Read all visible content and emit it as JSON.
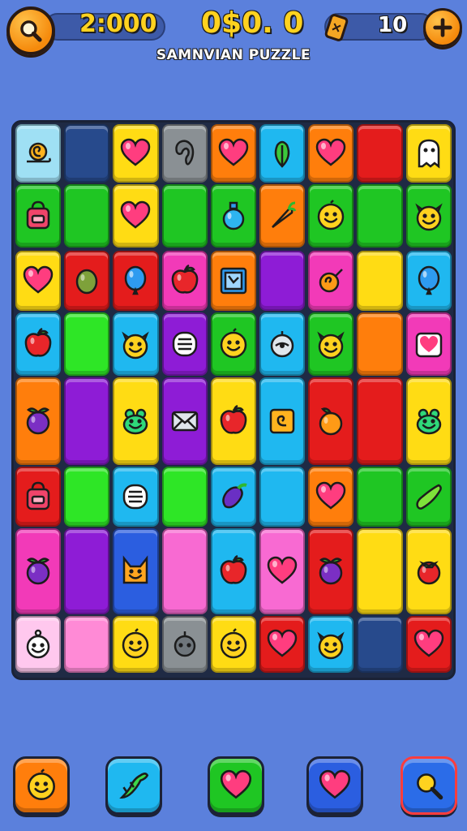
{
  "hud": {
    "title": "SAMNVIAN PUZZLE",
    "timer": "2:000",
    "score": "0$0. 0",
    "moves": "10"
  },
  "colors": {
    "bg": "#5b80dc",
    "lightblue": "#9fe0f4",
    "navy": "#274a8c",
    "yellow": "#ffdc14",
    "gray": "#8a9094",
    "orange": "#ff7e0c",
    "cyan": "#1fb8f0",
    "red": "#e41c1c",
    "green": "#1fc623",
    "lime": "#2ee626",
    "purple": "#8e1cd6",
    "magenta": "#f23ab8",
    "pink": "#ff8ad6",
    "blue": "#2b5ee0",
    "lightpink": "#ffc8ee",
    "lightmagenta": "#f86ad2"
  },
  "board": {
    "rows": [
      [
        {
          "color": "lightblue",
          "icon": "snail-icon"
        },
        {
          "color": "navy",
          "icon": ""
        },
        {
          "color": "yellow",
          "icon": "heart-icon"
        },
        {
          "color": "gray",
          "icon": "ear-icon"
        },
        {
          "color": "orange",
          "icon": "heart-icon"
        },
        {
          "color": "cyan",
          "icon": "leaf-icon"
        },
        {
          "color": "orange",
          "icon": "heart-icon"
        },
        {
          "color": "red",
          "icon": ""
        },
        {
          "color": "yellow",
          "icon": "ghost-icon"
        }
      ],
      [
        {
          "color": "green",
          "icon": "bag-icon"
        },
        {
          "color": "green",
          "icon": ""
        },
        {
          "color": "yellow",
          "icon": "heart-icon"
        },
        {
          "color": "green",
          "icon": ""
        },
        {
          "color": "green",
          "icon": "potion-icon"
        },
        {
          "color": "orange",
          "icon": "carrot-icon"
        },
        {
          "color": "green",
          "icon": "smiley-icon"
        },
        {
          "color": "green",
          "icon": ""
        },
        {
          "color": "green",
          "icon": "cat-face-icon"
        }
      ],
      [
        {
          "color": "yellow",
          "icon": "heart-icon"
        },
        {
          "color": "red",
          "icon": "olive-icon"
        },
        {
          "color": "red",
          "icon": "balloon-icon"
        },
        {
          "color": "magenta",
          "icon": "apple-icon"
        },
        {
          "color": "orange",
          "icon": "frame-icon"
        },
        {
          "color": "purple",
          "icon": ""
        },
        {
          "color": "magenta",
          "icon": "candy-icon"
        },
        {
          "color": "yellow",
          "icon": ""
        },
        {
          "color": "cyan",
          "icon": "balloon-icon"
        }
      ],
      [
        {
          "color": "cyan",
          "icon": "apple-icon"
        },
        {
          "color": "lime",
          "icon": ""
        },
        {
          "color": "cyan",
          "icon": "cat-face-icon"
        },
        {
          "color": "purple",
          "icon": "scroll-icon"
        },
        {
          "color": "green",
          "icon": "smiley-icon"
        },
        {
          "color": "cyan",
          "icon": "robot-icon"
        },
        {
          "color": "green",
          "icon": "cat-face-icon"
        },
        {
          "color": "orange",
          "icon": ""
        },
        {
          "color": "magenta",
          "icon": "heart-card-icon"
        }
      ],
      [
        {
          "color": "orange",
          "icon": "plum-icon"
        },
        {
          "color": "purple",
          "icon": ""
        },
        {
          "color": "yellow",
          "icon": "frog-icon"
        },
        {
          "color": "purple",
          "icon": "envelope-icon"
        },
        {
          "color": "yellow",
          "icon": "apple-icon"
        },
        {
          "color": "cyan",
          "icon": "spiral-box-icon"
        },
        {
          "color": "red",
          "icon": "orange-fruit-icon"
        },
        {
          "color": "red",
          "icon": ""
        },
        {
          "color": "yellow",
          "icon": "frog-icon"
        }
      ],
      [
        {
          "color": "red",
          "icon": "bag-icon"
        },
        {
          "color": "lime",
          "icon": ""
        },
        {
          "color": "cyan",
          "icon": "scroll-icon"
        },
        {
          "color": "lime",
          "icon": ""
        },
        {
          "color": "cyan",
          "icon": "eggplant-icon"
        },
        {
          "color": "cyan",
          "icon": ""
        },
        {
          "color": "orange",
          "icon": "heart-icon"
        },
        {
          "color": "green",
          "icon": ""
        },
        {
          "color": "green",
          "icon": "cucumber-icon"
        }
      ],
      [
        {
          "color": "magenta",
          "icon": "plum-icon"
        },
        {
          "color": "purple",
          "icon": ""
        },
        {
          "color": "blue",
          "icon": "fox-icon"
        },
        {
          "color": "lightmagenta",
          "icon": ""
        },
        {
          "color": "cyan",
          "icon": "apple-icon"
        },
        {
          "color": "lightmagenta",
          "icon": "heart-icon"
        },
        {
          "color": "red",
          "icon": "plum-icon"
        },
        {
          "color": "yellow",
          "icon": ""
        },
        {
          "color": "yellow",
          "icon": "tomato-icon"
        }
      ],
      [
        {
          "color": "lightpink",
          "icon": "ghost-face-icon"
        },
        {
          "color": "pink",
          "icon": ""
        },
        {
          "color": "yellow",
          "icon": "smiley-icon"
        },
        {
          "color": "gray",
          "icon": "bomb-icon"
        },
        {
          "color": "yellow",
          "icon": "smiley-icon"
        },
        {
          "color": "red",
          "icon": "heart-icon"
        },
        {
          "color": "cyan",
          "icon": "cat-face-icon"
        },
        {
          "color": "navy",
          "icon": ""
        },
        {
          "color": "red",
          "icon": "heart-icon"
        }
      ]
    ]
  },
  "toolbar": [
    {
      "icon": "smiley-icon",
      "color": "#ff7e0c"
    },
    {
      "icon": "lizard-icon",
      "color": "#1fb8f0"
    },
    {
      "icon": "heart-icon",
      "color": "#1fc623"
    },
    {
      "icon": "heart-icon",
      "color": "#2b5ee0"
    },
    {
      "icon": "search-icon",
      "color": "#2b6ce8"
    }
  ]
}
